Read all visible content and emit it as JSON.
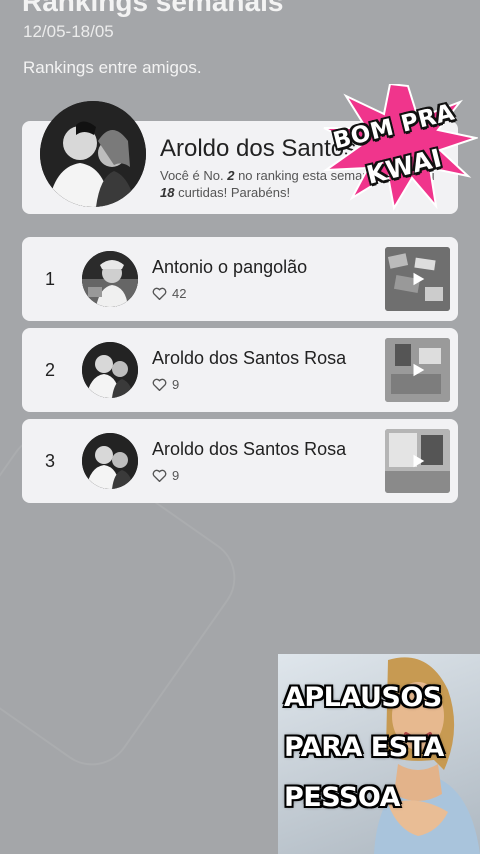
{
  "header": {
    "title": "Rankings semanais",
    "date_range": "12/05-18/05",
    "subtitle": "Rankings entre amigos."
  },
  "me": {
    "name": "Aroldo dos Santos",
    "msg_pre": "Você é No. ",
    "rank": "2",
    "msg_mid": " no ranking esta semana e ganhou ",
    "likes": "18",
    "msg_post": " curtidas! Parabéns!"
  },
  "rankings": [
    {
      "rank": "1",
      "name": "Antonio o pangolão",
      "likes": "42"
    },
    {
      "rank": "2",
      "name": "Aroldo dos Santos Rosa",
      "likes": "9"
    },
    {
      "rank": "3",
      "name": "Aroldo dos Santos Rosa",
      "likes": "9"
    }
  ],
  "sticker_top": {
    "line1": "BOM PRA",
    "line2": "KWAI"
  },
  "sticker_bottom": {
    "line1": "APLAUSOS",
    "line2": "PARA ESTA",
    "line3": "PESSOA"
  },
  "colors": {
    "background": "#a4a6a9",
    "card": "#f2f2f4",
    "burst": "#f0358c"
  },
  "icons": {
    "like": "heart-outline-icon",
    "play": "play-icon"
  }
}
